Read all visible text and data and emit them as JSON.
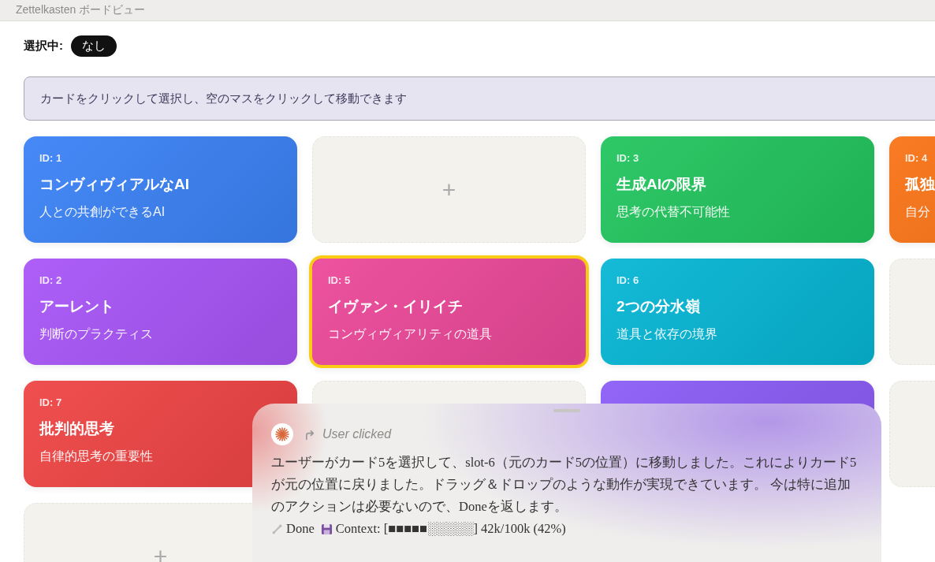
{
  "window": {
    "title": "Zettelkasten ボードビュー"
  },
  "selection": {
    "label": "選択中:",
    "value": "なし"
  },
  "hint": "カードをクリックして選択し、空のマスをクリックして移動できます",
  "board": [
    {
      "kind": "card",
      "id": "ID: 1",
      "title": "コンヴィヴィアルなAI",
      "subtitle": "人との共創ができるAI",
      "color": "#3b82f6",
      "selected": false
    },
    {
      "kind": "empty",
      "plus": "+"
    },
    {
      "kind": "card",
      "id": "ID: 3",
      "title": "生成AIの限界",
      "subtitle": "思考の代替不可能性",
      "color": "#22c55e",
      "selected": false
    },
    {
      "kind": "card",
      "id": "ID: 4",
      "title": "孤独",
      "subtitle": "自分",
      "color": "#f97316",
      "selected": false
    },
    {
      "kind": "card",
      "id": "ID: 2",
      "title": "アーレント",
      "subtitle": "判断のプラクティス",
      "color": "#a855f7",
      "selected": false
    },
    {
      "kind": "card",
      "id": "ID: 5",
      "title": "イヴァン・イリイチ",
      "subtitle": "コンヴィヴィアリティの道具",
      "color": "#ec4899",
      "selected": true
    },
    {
      "kind": "card",
      "id": "ID: 6",
      "title": "2つの分水嶺",
      "subtitle": "道具と依存の境界",
      "color": "#06b6d4",
      "selected": false
    },
    {
      "kind": "empty"
    },
    {
      "kind": "card",
      "id": "ID: 7",
      "title": "批判的思考",
      "subtitle": "自律的思考の重要性",
      "color": "#ef4444",
      "selected": false
    },
    {
      "kind": "empty"
    },
    {
      "kind": "card",
      "color": "#8b5cf6",
      "selected": false
    },
    {
      "kind": "empty"
    },
    {
      "kind": "empty",
      "plus": "+"
    }
  ],
  "chat": {
    "event": "User clicked",
    "message": "ユーザーがカード5を選択して、slot-6（元のカード5の位置）に移動しました。これによりカード5が元の位置に戻りました。ドラッグ＆ドロップのような動作が実現できています。 今は特に追加のアクションは必要ないので、Doneを返します。",
    "status": "Done",
    "context": "Context: [■■■■■░░░░░] 42k/100k (42%)"
  }
}
